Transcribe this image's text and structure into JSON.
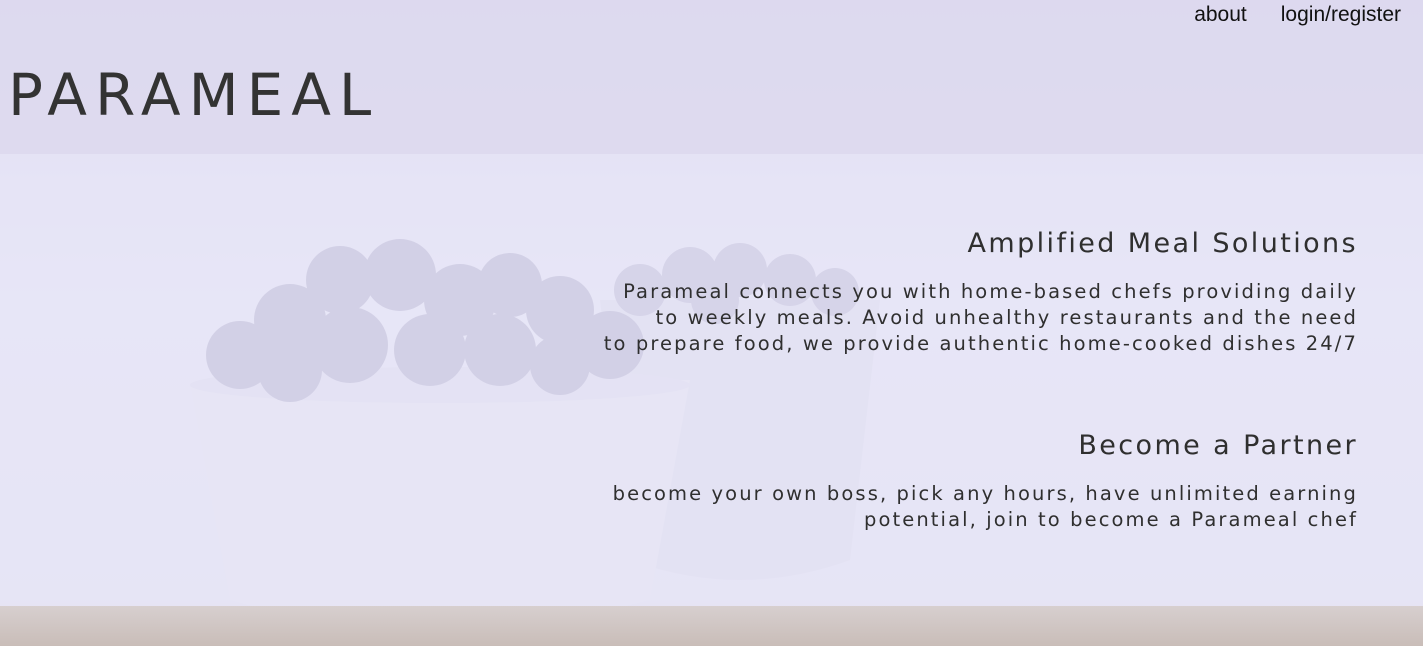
{
  "nav": {
    "about": "about",
    "login": "login/register"
  },
  "brand": {
    "logo": "PARAMEAL"
  },
  "sections": [
    {
      "title": "Amplified Meal Solutions",
      "lines": [
        "Parameal connects you with home-based chefs providing daily",
        "to weekly meals. Avoid unhealthy restaurants and the need",
        "to prepare food, we provide authentic home-cooked dishes 24/7"
      ]
    },
    {
      "title": "Become a Partner",
      "lines": [
        "become your own boss, pick any hours, have unlimited earning",
        "potential, join to become a Parameal chef"
      ]
    }
  ],
  "colors": {
    "header_bg": "#dedaf0",
    "panel_bg": "#e7e6f8",
    "text": "#333333"
  }
}
